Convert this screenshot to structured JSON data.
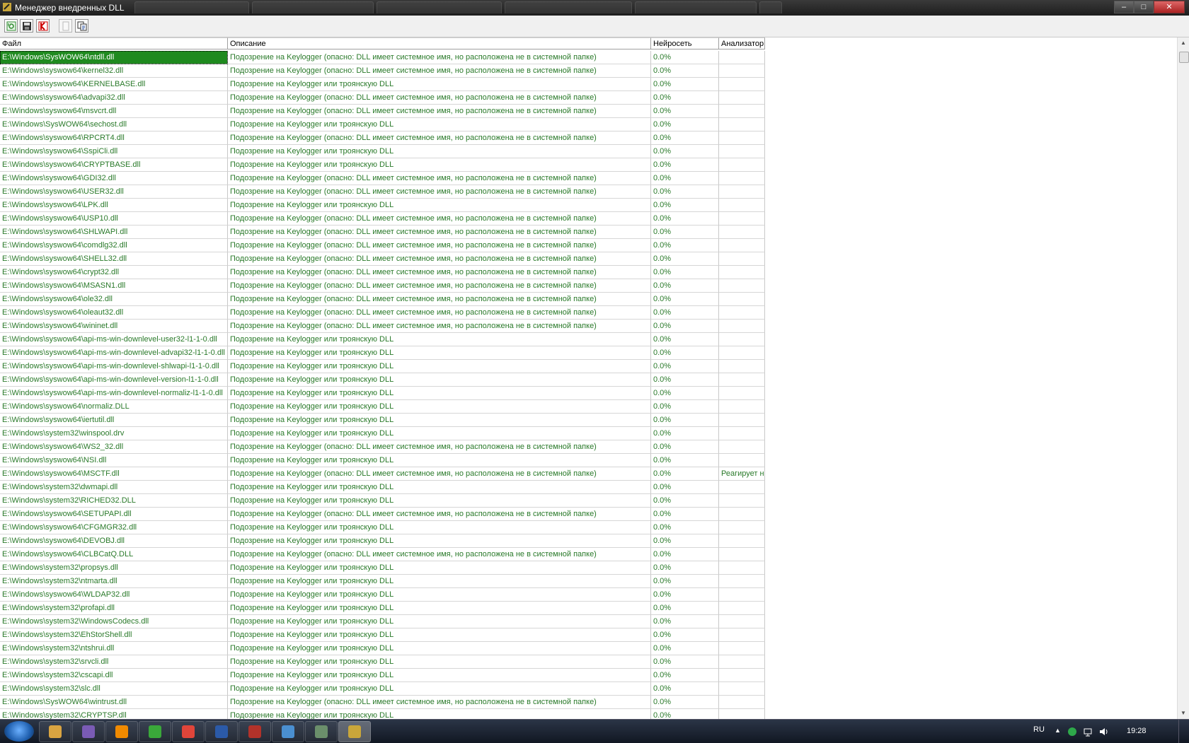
{
  "window": {
    "title": "Менеджер внедренных DLL"
  },
  "toolbar": {
    "buttons": [
      {
        "icon": "refresh-icon"
      },
      {
        "icon": "save-icon"
      },
      {
        "icon": "kaspersky-icon"
      },
      {
        "icon": "blank-icon"
      },
      {
        "icon": "copy-icon"
      }
    ]
  },
  "table": {
    "columns": [
      "Файл",
      "Описание",
      "Нейросеть",
      "Анализатор"
    ],
    "rows": [
      {
        "file": "E:\\Windows\\SysWOW64\\ntdll.dll",
        "desc": "Подозрение на Keylogger (опасно: DLL имеет системное имя, но расположена не в системной папке)",
        "nn": "0.0%",
        "an": ""
      },
      {
        "file": "E:\\Windows\\syswow64\\kernel32.dll",
        "desc": "Подозрение на Keylogger (опасно: DLL имеет системное имя, но расположена не в системной папке)",
        "nn": "0.0%",
        "an": ""
      },
      {
        "file": "E:\\Windows\\syswow64\\KERNELBASE.dll",
        "desc": "Подозрение на Keylogger или троянскую DLL",
        "nn": "0.0%",
        "an": ""
      },
      {
        "file": "E:\\Windows\\syswow64\\advapi32.dll",
        "desc": "Подозрение на Keylogger (опасно: DLL имеет системное имя, но расположена не в системной папке)",
        "nn": "0.0%",
        "an": ""
      },
      {
        "file": "E:\\Windows\\syswow64\\msvcrt.dll",
        "desc": "Подозрение на Keylogger (опасно: DLL имеет системное имя, но расположена не в системной папке)",
        "nn": "0.0%",
        "an": ""
      },
      {
        "file": "E:\\Windows\\SysWOW64\\sechost.dll",
        "desc": "Подозрение на Keylogger или троянскую DLL",
        "nn": "0.0%",
        "an": ""
      },
      {
        "file": "E:\\Windows\\syswow64\\RPCRT4.dll",
        "desc": "Подозрение на Keylogger (опасно: DLL имеет системное имя, но расположена не в системной папке)",
        "nn": "0.0%",
        "an": ""
      },
      {
        "file": "E:\\Windows\\syswow64\\SspiCli.dll",
        "desc": "Подозрение на Keylogger или троянскую DLL",
        "nn": "0.0%",
        "an": ""
      },
      {
        "file": "E:\\Windows\\syswow64\\CRYPTBASE.dll",
        "desc": "Подозрение на Keylogger или троянскую DLL",
        "nn": "0.0%",
        "an": ""
      },
      {
        "file": "E:\\Windows\\syswow64\\GDI32.dll",
        "desc": "Подозрение на Keylogger (опасно: DLL имеет системное имя, но расположена не в системной папке)",
        "nn": "0.0%",
        "an": ""
      },
      {
        "file": "E:\\Windows\\syswow64\\USER32.dll",
        "desc": "Подозрение на Keylogger (опасно: DLL имеет системное имя, но расположена не в системной папке)",
        "nn": "0.0%",
        "an": ""
      },
      {
        "file": "E:\\Windows\\syswow64\\LPK.dll",
        "desc": "Подозрение на Keylogger или троянскую DLL",
        "nn": "0.0%",
        "an": ""
      },
      {
        "file": "E:\\Windows\\syswow64\\USP10.dll",
        "desc": "Подозрение на Keylogger (опасно: DLL имеет системное имя, но расположена не в системной папке)",
        "nn": "0.0%",
        "an": ""
      },
      {
        "file": "E:\\Windows\\syswow64\\SHLWAPI.dll",
        "desc": "Подозрение на Keylogger (опасно: DLL имеет системное имя, но расположена не в системной папке)",
        "nn": "0.0%",
        "an": ""
      },
      {
        "file": "E:\\Windows\\syswow64\\comdlg32.dll",
        "desc": "Подозрение на Keylogger (опасно: DLL имеет системное имя, но расположена не в системной папке)",
        "nn": "0.0%",
        "an": ""
      },
      {
        "file": "E:\\Windows\\syswow64\\SHELL32.dll",
        "desc": "Подозрение на Keylogger (опасно: DLL имеет системное имя, но расположена не в системной папке)",
        "nn": "0.0%",
        "an": ""
      },
      {
        "file": "E:\\Windows\\syswow64\\crypt32.dll",
        "desc": "Подозрение на Keylogger (опасно: DLL имеет системное имя, но расположена не в системной папке)",
        "nn": "0.0%",
        "an": ""
      },
      {
        "file": "E:\\Windows\\syswow64\\MSASN1.dll",
        "desc": "Подозрение на Keylogger (опасно: DLL имеет системное имя, но расположена не в системной папке)",
        "nn": "0.0%",
        "an": ""
      },
      {
        "file": "E:\\Windows\\syswow64\\ole32.dll",
        "desc": "Подозрение на Keylogger (опасно: DLL имеет системное имя, но расположена не в системной папке)",
        "nn": "0.0%",
        "an": ""
      },
      {
        "file": "E:\\Windows\\syswow64\\oleaut32.dll",
        "desc": "Подозрение на Keylogger (опасно: DLL имеет системное имя, но расположена не в системной папке)",
        "nn": "0.0%",
        "an": ""
      },
      {
        "file": "E:\\Windows\\syswow64\\wininet.dll",
        "desc": "Подозрение на Keylogger (опасно: DLL имеет системное имя, но расположена не в системной папке)",
        "nn": "0.0%",
        "an": ""
      },
      {
        "file": "E:\\Windows\\syswow64\\api-ms-win-downlevel-user32-l1-1-0.dll",
        "desc": "Подозрение на Keylogger или троянскую DLL",
        "nn": "0.0%",
        "an": ""
      },
      {
        "file": "E:\\Windows\\syswow64\\api-ms-win-downlevel-advapi32-l1-1-0.dll",
        "desc": "Подозрение на Keylogger или троянскую DLL",
        "nn": "0.0%",
        "an": ""
      },
      {
        "file": "E:\\Windows\\syswow64\\api-ms-win-downlevel-shlwapi-l1-1-0.dll",
        "desc": "Подозрение на Keylogger или троянскую DLL",
        "nn": "0.0%",
        "an": ""
      },
      {
        "file": "E:\\Windows\\syswow64\\api-ms-win-downlevel-version-l1-1-0.dll",
        "desc": "Подозрение на Keylogger или троянскую DLL",
        "nn": "0.0%",
        "an": ""
      },
      {
        "file": "E:\\Windows\\syswow64\\api-ms-win-downlevel-normaliz-l1-1-0.dll",
        "desc": "Подозрение на Keylogger или троянскую DLL",
        "nn": "0.0%",
        "an": ""
      },
      {
        "file": "E:\\Windows\\syswow64\\normaliz.DLL",
        "desc": "Подозрение на Keylogger или троянскую DLL",
        "nn": "0.0%",
        "an": ""
      },
      {
        "file": "E:\\Windows\\syswow64\\iertutil.dll",
        "desc": "Подозрение на Keylogger или троянскую DLL",
        "nn": "0.0%",
        "an": ""
      },
      {
        "file": "E:\\Windows\\system32\\winspool.drv",
        "desc": "Подозрение на Keylogger или троянскую DLL",
        "nn": "0.0%",
        "an": ""
      },
      {
        "file": "E:\\Windows\\syswow64\\WS2_32.dll",
        "desc": "Подозрение на Keylogger (опасно: DLL имеет системное имя, но расположена не в системной папке)",
        "nn": "0.0%",
        "an": ""
      },
      {
        "file": "E:\\Windows\\syswow64\\NSI.dll",
        "desc": "Подозрение на Keylogger или троянскую DLL",
        "nn": "0.0%",
        "an": ""
      },
      {
        "file": "E:\\Windows\\syswow64\\MSCTF.dll",
        "desc": "Подозрение на Keylogger (опасно: DLL имеет системное имя, но расположена не в системной папке)",
        "nn": "0.0%",
        "an": "Реагирует на"
      },
      {
        "file": "E:\\Windows\\system32\\dwmapi.dll",
        "desc": "Подозрение на Keylogger или троянскую DLL",
        "nn": "0.0%",
        "an": ""
      },
      {
        "file": "E:\\Windows\\system32\\RICHED32.DLL",
        "desc": "Подозрение на Keylogger или троянскую DLL",
        "nn": "0.0%",
        "an": ""
      },
      {
        "file": "E:\\Windows\\syswow64\\SETUPAPI.dll",
        "desc": "Подозрение на Keylogger (опасно: DLL имеет системное имя, но расположена не в системной папке)",
        "nn": "0.0%",
        "an": ""
      },
      {
        "file": "E:\\Windows\\syswow64\\CFGMGR32.dll",
        "desc": "Подозрение на Keylogger или троянскую DLL",
        "nn": "0.0%",
        "an": ""
      },
      {
        "file": "E:\\Windows\\syswow64\\DEVOBJ.dll",
        "desc": "Подозрение на Keylogger или троянскую DLL",
        "nn": "0.0%",
        "an": ""
      },
      {
        "file": "E:\\Windows\\syswow64\\CLBCatQ.DLL",
        "desc": "Подозрение на Keylogger (опасно: DLL имеет системное имя, но расположена не в системной папке)",
        "nn": "0.0%",
        "an": ""
      },
      {
        "file": "E:\\Windows\\system32\\propsys.dll",
        "desc": "Подозрение на Keylogger или троянскую DLL",
        "nn": "0.0%",
        "an": ""
      },
      {
        "file": "E:\\Windows\\system32\\ntmarta.dll",
        "desc": "Подозрение на Keylogger или троянскую DLL",
        "nn": "0.0%",
        "an": ""
      },
      {
        "file": "E:\\Windows\\syswow64\\WLDAP32.dll",
        "desc": "Подозрение на Keylogger или троянскую DLL",
        "nn": "0.0%",
        "an": ""
      },
      {
        "file": "E:\\Windows\\system32\\profapi.dll",
        "desc": "Подозрение на Keylogger или троянскую DLL",
        "nn": "0.0%",
        "an": ""
      },
      {
        "file": "E:\\Windows\\system32\\WindowsCodecs.dll",
        "desc": "Подозрение на Keylogger или троянскую DLL",
        "nn": "0.0%",
        "an": ""
      },
      {
        "file": "E:\\Windows\\system32\\EhStorShell.dll",
        "desc": "Подозрение на Keylogger или троянскую DLL",
        "nn": "0.0%",
        "an": ""
      },
      {
        "file": "E:\\Windows\\system32\\ntshrui.dll",
        "desc": "Подозрение на Keylogger или троянскую DLL",
        "nn": "0.0%",
        "an": ""
      },
      {
        "file": "E:\\Windows\\system32\\srvcli.dll",
        "desc": "Подозрение на Keylogger или троянскую DLL",
        "nn": "0.0%",
        "an": ""
      },
      {
        "file": "E:\\Windows\\system32\\cscapi.dll",
        "desc": "Подозрение на Keylogger или троянскую DLL",
        "nn": "0.0%",
        "an": ""
      },
      {
        "file": "E:\\Windows\\system32\\slc.dll",
        "desc": "Подозрение на Keylogger или троянскую DLL",
        "nn": "0.0%",
        "an": ""
      },
      {
        "file": "E:\\Windows\\SysWOW64\\wintrust.dll",
        "desc": "Подозрение на Keylogger (опасно: DLL имеет системное имя, но расположена не в системной папке)",
        "nn": "0.0%",
        "an": ""
      },
      {
        "file": "E:\\Windows\\system32\\CRYPTSP.dll",
        "desc": "Подозрение на Keylogger или троянскую DLL",
        "nn": "0.0%",
        "an": ""
      }
    ]
  },
  "taskbar": {
    "apps": [
      {
        "icon": "explorer-icon",
        "color": "#d9a441"
      },
      {
        "icon": "visual-studio-icon",
        "color": "#7a5bb5"
      },
      {
        "icon": "avast-icon",
        "color": "#f08a00"
      },
      {
        "icon": "green-app-icon",
        "color": "#3aa83a"
      },
      {
        "icon": "chrome-icon",
        "color": "#e0453a"
      },
      {
        "icon": "word-icon",
        "color": "#2b5aa8"
      },
      {
        "icon": "red-app-icon",
        "color": "#b2322a"
      },
      {
        "icon": "network-app-icon",
        "color": "#4a8fd0"
      },
      {
        "icon": "monitor-app-icon",
        "color": "#6b8f6b"
      },
      {
        "icon": "avz-icon",
        "color": "#c9a63a"
      }
    ],
    "tray": {
      "language": "RU",
      "time": "19:28"
    }
  },
  "colors": {
    "selected_row": "#1f8a1f",
    "row_text": "#2a7a2a"
  }
}
